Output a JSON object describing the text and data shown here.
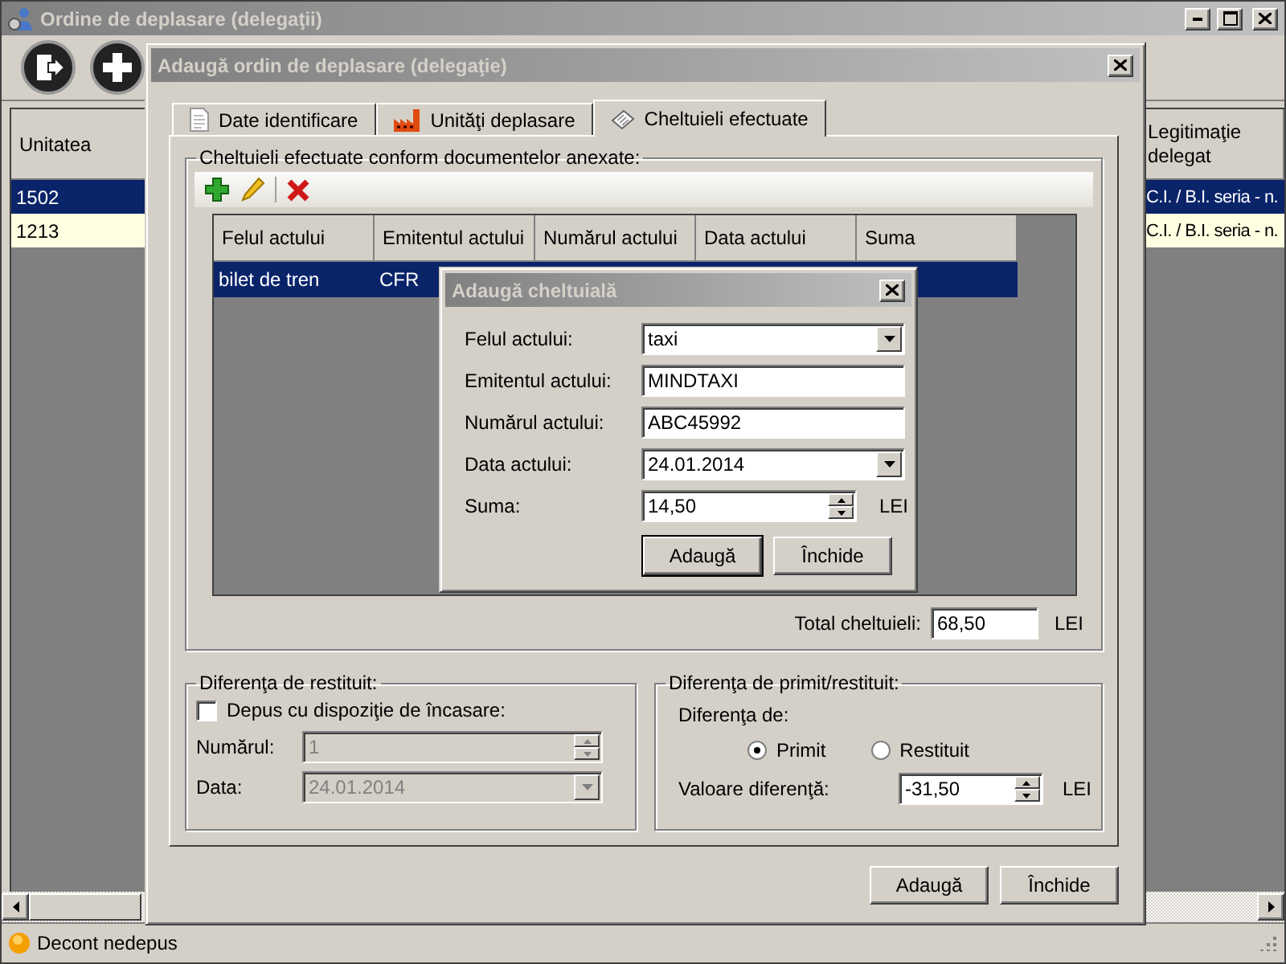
{
  "main_window": {
    "title": "Ordine de deplasare (delegaţii)",
    "grid": {
      "columns": [
        "Unitatea",
        "Legitimaţie delegat"
      ],
      "rows": [
        {
          "selected": true,
          "cells": [
            "1502",
            "C.I. / B.I. seria - n."
          ]
        },
        {
          "selected": false,
          "cells": [
            "1213",
            "C.I. / B.I. seria - n."
          ]
        }
      ]
    },
    "status_bar": "Decont nedepus"
  },
  "order_dialog": {
    "title": "Adaugă ordin de deplasare (delegaţie)",
    "tabs": [
      {
        "label": "Date identificare",
        "kind": "document",
        "selected": false
      },
      {
        "label": "Unităţi deplasare",
        "kind": "factory",
        "selected": false
      },
      {
        "label": "Cheltuieli efectuate",
        "kind": "receipt",
        "selected": true
      }
    ],
    "expenses_group": {
      "title": "Cheltuieli efectuate conform documentelor anexate:",
      "columns": [
        "Felul actului",
        "Emitentul actului",
        "Numărul actului",
        "Data actului",
        "Suma"
      ],
      "rows": [
        {
          "selected": true,
          "cells": [
            "bilet de tren",
            "CFR"
          ]
        }
      ],
      "total_label": "Total cheltuieli:",
      "total_value": "68,50",
      "total_unit": "LEI"
    },
    "refund_group": {
      "title": "Diferenţa de restituit:",
      "deposit_label": "Depus cu dispoziţie de încasare:",
      "deposit_checked": false,
      "disabled": true,
      "number_label": "Numărul:",
      "number_value": "1",
      "date_label": "Data:",
      "date_value": "24.01.2014"
    },
    "difference_group": {
      "title": "Diferenţa de primit/restituit:",
      "type_label": "Diferenţa de:",
      "options": [
        {
          "label": "Primit",
          "selected": true
        },
        {
          "label": "Restituit",
          "selected": false
        }
      ],
      "value_label": "Valoare diferenţă:",
      "value": "-31,50",
      "unit": "LEI"
    },
    "buttons": [
      "Adaugă",
      "Închide"
    ]
  },
  "expense_dialog": {
    "title": "Adaugă cheltuială",
    "fields": [
      {
        "label": "Felul actului:",
        "value": "taxi",
        "kind": "combo"
      },
      {
        "label": "Emitentul actului:",
        "value": "MINDTAXI",
        "kind": "text"
      },
      {
        "label": "Numărul actului:",
        "value": "ABC45992",
        "kind": "text"
      },
      {
        "label": "Data actului:",
        "value": "24.01.2014",
        "kind": "combo"
      },
      {
        "label": "Suma:",
        "value": "14,50",
        "kind": "spinner",
        "unit": "LEI"
      }
    ],
    "buttons": [
      {
        "label": "Adaugă",
        "default": true
      },
      {
        "label": "Închide",
        "default": false
      }
    ]
  }
}
